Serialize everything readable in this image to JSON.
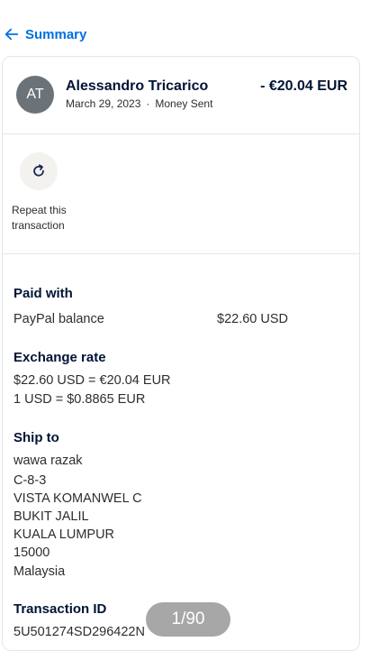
{
  "nav": {
    "back_label": "Summary"
  },
  "transaction": {
    "avatar_initials": "AT",
    "name": "Alessandro Tricarico",
    "date": "March 29, 2023",
    "separator": "·",
    "type": "Money Sent",
    "amount": "- €20.04 EUR"
  },
  "repeat": {
    "label": "Repeat this transaction"
  },
  "paid_with": {
    "title": "Paid with",
    "method": "PayPal balance",
    "amount": "$22.60 USD"
  },
  "exchange_rate": {
    "title": "Exchange rate",
    "line1": "$22.60 USD = €20.04 EUR",
    "line2": "1 USD = $0.8865 EUR"
  },
  "ship_to": {
    "title": "Ship to",
    "lines": [
      "wawa razak",
      "C-8-3",
      "VISTA KOMANWEL C",
      "BUKIT JALIL",
      "KUALA LUMPUR",
      "15000",
      "Malaysia"
    ]
  },
  "transaction_id": {
    "title": "Transaction ID",
    "value": "5U501274SD296422N"
  },
  "pager": {
    "label": "1/90"
  },
  "colors": {
    "accent": "#0070e0",
    "avatar_bg": "#6c7378",
    "text": "#001435"
  },
  "icons": {
    "back": "arrow-left-icon",
    "repeat": "refresh-icon"
  }
}
